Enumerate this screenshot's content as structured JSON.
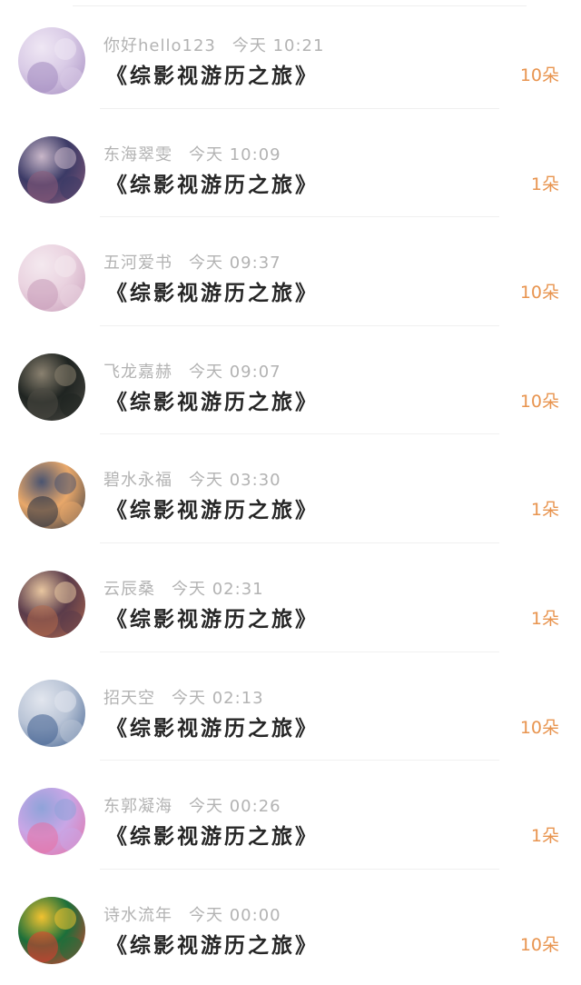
{
  "gifts": [
    {
      "user": "你好hello123",
      "time": "今天 10:21",
      "book": "《综影视游历之旅》",
      "count": "10朵",
      "colors": [
        "#d9cbe6",
        "#a38abf",
        "#efe7f4"
      ]
    },
    {
      "user": "东海翠雯",
      "time": "今天 10:09",
      "book": "《综影视游历之旅》",
      "count": "1朵",
      "colors": [
        "#3b3a66",
        "#8d5b7a",
        "#c9b7c9"
      ]
    },
    {
      "user": "五河爱书",
      "time": "今天 09:37",
      "book": "《综影视游历之旅》",
      "count": "10朵",
      "colors": [
        "#ead3e0",
        "#c79bb8",
        "#f4e9ef"
      ]
    },
    {
      "user": "飞龙嘉赫",
      "time": "今天 09:07",
      "book": "《综影视游历之旅》",
      "count": "10朵",
      "colors": [
        "#1f2421",
        "#4c4a44",
        "#8a8170"
      ]
    },
    {
      "user": "碧水永福",
      "time": "今天 03:30",
      "book": "《综影视游历之旅》",
      "count": "1朵",
      "colors": [
        "#e9a86a",
        "#27303f",
        "#4a5470"
      ]
    },
    {
      "user": "云辰桑",
      "time": "今天 02:31",
      "book": "《综影视游历之旅》",
      "count": "1朵",
      "colors": [
        "#5a3b4a",
        "#b3694d",
        "#e8c6a0"
      ]
    },
    {
      "user": "招天空",
      "time": "今天 02:13",
      "book": "《综影视游历之旅》",
      "count": "10朵",
      "colors": [
        "#b9c4d6",
        "#3f5f8f",
        "#e2e6ee"
      ]
    },
    {
      "user": "东郭凝海",
      "time": "今天 00:26",
      "book": "《综影视游历之旅》",
      "count": "1朵",
      "colors": [
        "#c9a6e6",
        "#e76fa3",
        "#8fa3d9"
      ]
    },
    {
      "user": "诗水流年",
      "time": "今天 00:00",
      "book": "《综影视游历之旅》",
      "count": "10朵",
      "colors": [
        "#1b6f3a",
        "#e33b2f",
        "#f2c230"
      ]
    }
  ]
}
